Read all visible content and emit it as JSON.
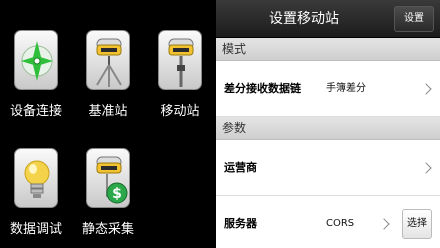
{
  "launcher": {
    "apps": [
      {
        "label": "设备连接",
        "icon": "compass-icon"
      },
      {
        "label": "基准站",
        "icon": "gnss-base-tripod-icon"
      },
      {
        "label": "移动站",
        "icon": "gnss-rover-pole-icon"
      },
      {
        "label": "数据调试",
        "icon": "light-bulb-icon"
      },
      {
        "label": "静态采集",
        "icon": "gnss-receiver-dollar-icon"
      }
    ]
  },
  "panel": {
    "title": "设置移动站",
    "settings_button": "设置",
    "sections": {
      "mode": "模式",
      "params": "参数"
    },
    "rows": {
      "diff_link": {
        "label": "差分接收数据链",
        "value": "手簿差分"
      },
      "operator": {
        "label": "运营商",
        "value": ""
      },
      "server": {
        "label": "服务器",
        "value": "CORS"
      }
    },
    "select_button": "选择"
  },
  "colors": {
    "titlebar": "#222222",
    "section_bg": "#d8d8d8",
    "compass_green": "#2fbf3a",
    "dollar_green": "#2aa84a",
    "bulb_yellow": "#f4d34a"
  }
}
